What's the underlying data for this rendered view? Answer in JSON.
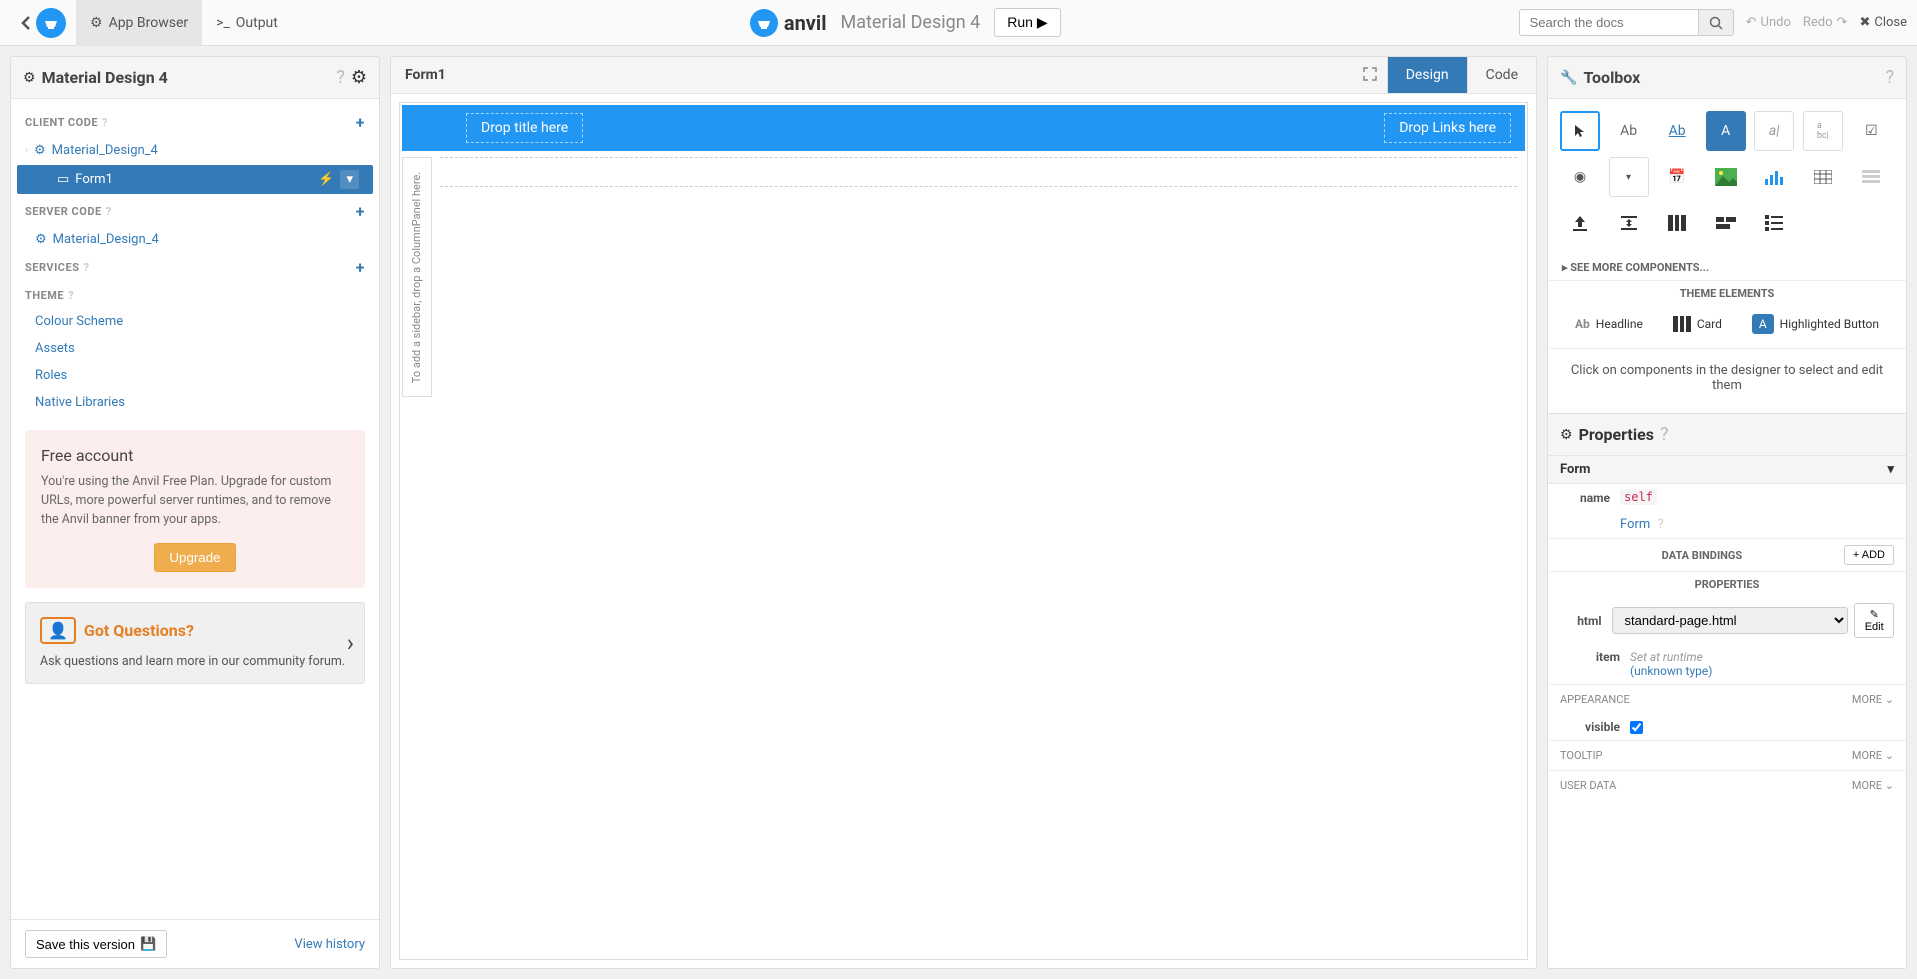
{
  "topbar": {
    "app_browser": "App Browser",
    "output": "Output",
    "brand": "anvil",
    "app_name": "Material Design 4",
    "run": "Run",
    "search_placeholder": "Search the docs",
    "undo": "Undo",
    "redo": "Redo",
    "close": "Close"
  },
  "left": {
    "title": "Material Design 4",
    "sections": {
      "client_code": "CLIENT CODE",
      "server_code": "SERVER CODE",
      "services": "SERVICES",
      "theme": "THEME"
    },
    "module1": "Material_Design_4",
    "form1": "Form1",
    "server_module": "Material_Design_4",
    "theme_items": {
      "colour": "Colour Scheme",
      "assets": "Assets",
      "roles": "Roles",
      "native": "Native Libraries"
    },
    "free": {
      "title": "Free account",
      "text": "You're using the Anvil Free Plan. Upgrade for custom URLs, more powerful server runtimes, and to remove the Anvil banner from your apps.",
      "upgrade": "Upgrade"
    },
    "questions": {
      "title": "Got Questions?",
      "text": "Ask questions and learn more in our community forum."
    },
    "save": "Save this version",
    "view_history": "View history"
  },
  "center": {
    "title": "Form1",
    "design_tab": "Design",
    "code_tab": "Code",
    "drop_title": "Drop title here",
    "drop_links": "Drop Links here",
    "sidebar_hint": "To add a sidebar, drop a ColumnPanel here."
  },
  "right": {
    "toolbox": "Toolbox",
    "see_more": "SEE MORE COMPONENTS...",
    "theme_elements": "THEME ELEMENTS",
    "headline": "Headline",
    "card": "Card",
    "highlighted_btn": "Highlighted Button",
    "hint": "Click on components in the designer to select and edit them",
    "properties": "Properties",
    "form_type": "Form",
    "name_label": "name",
    "name_value": "self",
    "form_link": "Form",
    "data_bindings": "DATA BINDINGS",
    "add": "ADD",
    "properties_section": "PROPERTIES",
    "html_label": "html",
    "html_value": "standard-page.html",
    "edit": "Edit",
    "item_label": "item",
    "item_runtime": "Set at runtime",
    "item_unknown": "(unknown type)",
    "appearance": "APPEARANCE",
    "visible_label": "visible",
    "tooltip": "TOOLTIP",
    "user_data": "USER DATA",
    "more": "MORE"
  }
}
